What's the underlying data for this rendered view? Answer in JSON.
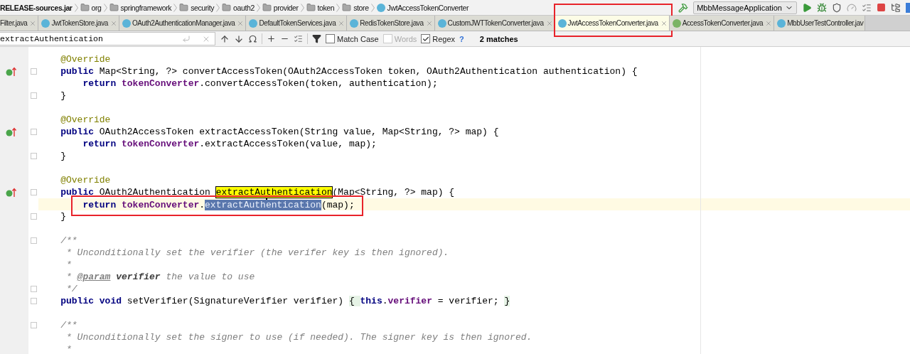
{
  "breadcrumb": [
    {
      "kind": "jar",
      "label": "RELEASE-sources.jar"
    },
    {
      "kind": "folder",
      "label": "org"
    },
    {
      "kind": "folder",
      "label": "springframework"
    },
    {
      "kind": "folder",
      "label": "security"
    },
    {
      "kind": "folder",
      "label": "oauth2"
    },
    {
      "kind": "folder",
      "label": "provider"
    },
    {
      "kind": "folder",
      "label": "token"
    },
    {
      "kind": "folder",
      "label": "store"
    },
    {
      "kind": "class",
      "label": "JwtAccessTokenConverter"
    }
  ],
  "run_configuration": "MbbMessageApplication",
  "tabs": [
    {
      "kind": "plain",
      "label": "Filter.java",
      "selected": false,
      "closable": true,
      "framed": false
    },
    {
      "kind": "class",
      "label": "JwtTokenStore.java",
      "selected": false,
      "closable": true,
      "framed": false
    },
    {
      "kind": "class",
      "label": "OAuth2AuthenticationManager.java",
      "selected": false,
      "closable": true,
      "framed": false
    },
    {
      "kind": "class",
      "label": "DefaultTokenServices.java",
      "selected": false,
      "closable": true,
      "framed": false
    },
    {
      "kind": "class",
      "label": "RedisTokenStore.java",
      "selected": false,
      "closable": true,
      "framed": false
    },
    {
      "kind": "class",
      "label": "CustomJWTTokenConverter.java",
      "selected": false,
      "closable": true,
      "framed": false
    },
    {
      "kind": "class",
      "label": "JwtAccessTokenConverter.java",
      "selected": true,
      "closable": true,
      "framed": true
    },
    {
      "kind": "interface",
      "label": "AccessTokenConverter.java",
      "selected": false,
      "closable": true,
      "framed": false
    },
    {
      "kind": "class",
      "label": "MbbUserTestController.jav",
      "selected": false,
      "closable": false,
      "framed": false
    }
  ],
  "search": {
    "value": "extractAuthentication",
    "options": [
      {
        "label": "Match Case",
        "checked": false,
        "disabled": false
      },
      {
        "label": "Words",
        "checked": false,
        "disabled": true
      },
      {
        "label": "Regex",
        "checked": true,
        "disabled": false
      }
    ],
    "help": "?",
    "matches": "2 matches"
  },
  "code_lines": [
    {
      "kind": "member",
      "fold_marker": false,
      "gutter_icon": false,
      "current": false,
      "framed": false,
      "tokens": [
        {
          "kind": "annotation",
          "text": "@Override"
        }
      ]
    },
    {
      "kind": "member",
      "fold_marker": true,
      "gutter_icon": true,
      "current": false,
      "framed": false,
      "tokens": [
        {
          "kind": "keyword",
          "text": "public"
        },
        {
          "kind": "plain",
          "text": " Map<String, ?> convertAccessToken(OAuth2AccessToken token, OAuth2Authentication authentication) {"
        }
      ]
    },
    {
      "kind": "body",
      "fold_marker": false,
      "gutter_icon": false,
      "current": false,
      "framed": false,
      "tokens": [
        {
          "kind": "keyword",
          "text": "return"
        },
        {
          "kind": "field",
          "text": " tokenConverter"
        },
        {
          "kind": "plain",
          "text": ".convertAccessToken(token, authentication);"
        }
      ]
    },
    {
      "kind": "member",
      "fold_marker": true,
      "gutter_icon": false,
      "current": false,
      "framed": false,
      "tokens": [
        {
          "kind": "plain",
          "text": "}"
        }
      ]
    },
    {
      "kind": "blank",
      "fold_marker": false,
      "gutter_icon": false,
      "current": false,
      "framed": false
    },
    {
      "kind": "member",
      "fold_marker": false,
      "gutter_icon": false,
      "current": false,
      "framed": false,
      "tokens": [
        {
          "kind": "annotation",
          "text": "@Override"
        }
      ]
    },
    {
      "kind": "member",
      "fold_marker": true,
      "gutter_icon": true,
      "current": false,
      "framed": false,
      "tokens": [
        {
          "kind": "keyword",
          "text": "public"
        },
        {
          "kind": "plain",
          "text": " OAuth2AccessToken extractAccessToken(String value, Map<String, ?> map) {"
        }
      ]
    },
    {
      "kind": "body",
      "fold_marker": false,
      "gutter_icon": false,
      "current": false,
      "framed": false,
      "tokens": [
        {
          "kind": "keyword",
          "text": "return"
        },
        {
          "kind": "field",
          "text": " tokenConverter"
        },
        {
          "kind": "plain",
          "text": ".extractAccessToken(value, map);"
        }
      ]
    },
    {
      "kind": "member",
      "fold_marker": true,
      "gutter_icon": false,
      "current": false,
      "framed": false,
      "tokens": [
        {
          "kind": "plain",
          "text": "}"
        }
      ]
    },
    {
      "kind": "blank",
      "fold_marker": false,
      "gutter_icon": false,
      "current": false,
      "framed": false
    },
    {
      "kind": "member",
      "fold_marker": false,
      "gutter_icon": false,
      "current": false,
      "framed": false,
      "tokens": [
        {
          "kind": "annotation",
          "text": "@Override"
        }
      ]
    },
    {
      "kind": "member",
      "fold_marker": true,
      "gutter_icon": true,
      "current": false,
      "framed": false,
      "tokens": [
        {
          "kind": "keyword",
          "text": "public"
        },
        {
          "kind": "plain",
          "text": " OAuth2Authentication "
        },
        {
          "kind": "match",
          "text": "extractAuthentication"
        },
        {
          "kind": "plain",
          "text": "(Map<String, ?> map) {"
        }
      ]
    },
    {
      "kind": "body",
      "fold_marker": false,
      "gutter_icon": false,
      "current": true,
      "framed": true,
      "tokens": [
        {
          "kind": "keyword",
          "text": "return"
        },
        {
          "kind": "field",
          "text": " tokenConverter"
        },
        {
          "kind": "plain",
          "text": "."
        },
        {
          "kind": "selection",
          "text": "extractAuth"
        },
        {
          "kind": "caret"
        },
        {
          "kind": "selection",
          "text": "entication"
        },
        {
          "kind": "plain",
          "text": "(map);"
        }
      ]
    },
    {
      "kind": "member",
      "fold_marker": true,
      "gutter_icon": false,
      "current": false,
      "framed": false,
      "tokens": [
        {
          "kind": "plain",
          "text": "}"
        }
      ]
    },
    {
      "kind": "blank",
      "fold_marker": false,
      "gutter_icon": false,
      "current": false,
      "framed": false
    },
    {
      "kind": "member",
      "fold_marker": true,
      "gutter_icon": false,
      "current": false,
      "framed": false,
      "tokens": [
        {
          "kind": "comment",
          "text": "/**"
        }
      ]
    },
    {
      "kind": "doc",
      "fold_marker": false,
      "gutter_icon": false,
      "current": false,
      "framed": false,
      "tokens": [
        {
          "kind": "comment",
          "text": "* Unconditionally set the verifier (the verifer key is then ignored)."
        }
      ]
    },
    {
      "kind": "doc",
      "fold_marker": false,
      "gutter_icon": false,
      "current": false,
      "framed": false,
      "tokens": [
        {
          "kind": "comment",
          "text": "*"
        }
      ]
    },
    {
      "kind": "doc",
      "fold_marker": false,
      "gutter_icon": false,
      "current": false,
      "framed": false,
      "tokens": [
        {
          "kind": "comment",
          "text": "* "
        },
        {
          "kind": "doc_tag",
          "text": "@param"
        },
        {
          "kind": "doc_param",
          "text": " verifier"
        },
        {
          "kind": "comment",
          "text": " the value to use"
        }
      ]
    },
    {
      "kind": "doc",
      "fold_marker": true,
      "gutter_icon": false,
      "current": false,
      "framed": false,
      "tokens": [
        {
          "kind": "comment",
          "text": "*/"
        }
      ]
    },
    {
      "kind": "member",
      "fold_marker": true,
      "gutter_icon": false,
      "current": false,
      "framed": false,
      "tokens": [
        {
          "kind": "keyword",
          "text": "public void"
        },
        {
          "kind": "plain",
          "text": " setVerifier(SignatureVerifier verifier) "
        },
        {
          "kind": "folded",
          "text": "{ "
        },
        {
          "kind": "keyword",
          "text": "this"
        },
        {
          "kind": "plain",
          "text": "."
        },
        {
          "kind": "field",
          "text": "verifier"
        },
        {
          "kind": "plain",
          "text": " = verifier; "
        },
        {
          "kind": "folded",
          "text": "}"
        }
      ]
    },
    {
      "kind": "blank",
      "fold_marker": false,
      "gutter_icon": false,
      "current": false,
      "framed": false
    },
    {
      "kind": "member",
      "fold_marker": true,
      "gutter_icon": false,
      "current": false,
      "framed": false,
      "tokens": [
        {
          "kind": "comment",
          "text": "/**"
        }
      ]
    },
    {
      "kind": "doc",
      "fold_marker": false,
      "gutter_icon": false,
      "current": false,
      "framed": false,
      "tokens": [
        {
          "kind": "comment",
          "text": "* Unconditionally set the signer to use (if needed). The signer key is then ignored."
        }
      ]
    },
    {
      "kind": "doc",
      "fold_marker": false,
      "gutter_icon": false,
      "current": false,
      "framed": false,
      "tokens": [
        {
          "kind": "comment",
          "text": "*"
        }
      ]
    }
  ]
}
